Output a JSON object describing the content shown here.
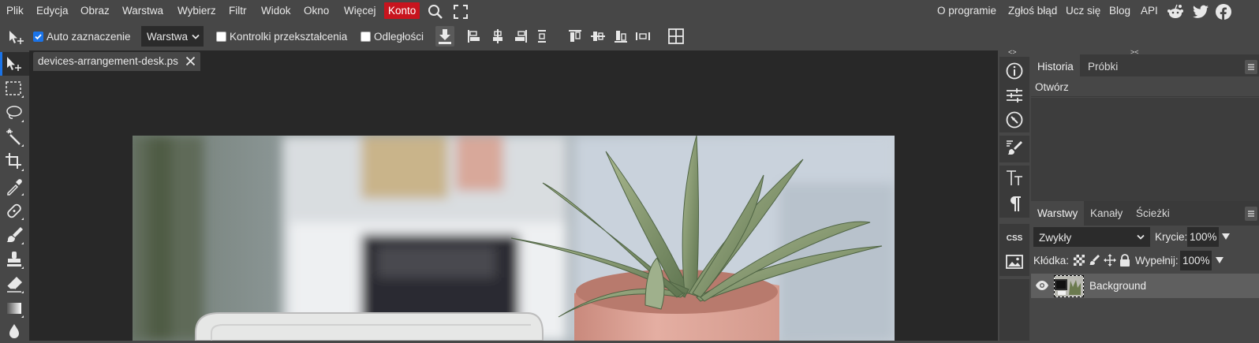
{
  "menu": {
    "items": [
      "Plik",
      "Edycja",
      "Obraz",
      "Warstwa",
      "Wybierz",
      "Filtr",
      "Widok",
      "Okno",
      "Więcej"
    ],
    "account": "Konto",
    "right_links": [
      "O programie",
      "Zgłoś błąd",
      "Ucz się",
      "Blog",
      "API"
    ],
    "accent_color": "#c8141e"
  },
  "options": {
    "auto_select_label": "Auto zaznaczenie",
    "auto_select_checked": true,
    "target_select": "Warstwa",
    "transform_controls_label": "Kontrolki przekształcenia",
    "transform_controls_checked": false,
    "distances_label": "Odległości",
    "distances_checked": false
  },
  "document": {
    "tab_title": "devices-arrangement-desk.psd"
  },
  "side_toggles": {
    "left": "<>",
    "right": "><"
  },
  "history_panel": {
    "tabs": [
      "Historia",
      "Próbki"
    ],
    "active_tab": "Historia",
    "entries": [
      "Otwórz"
    ]
  },
  "layers_panel": {
    "tabs": [
      "Warstwy",
      "Kanały",
      "Ścieżki"
    ],
    "active_tab": "Warstwy",
    "blend_mode": "Zwykły",
    "opacity_label": "Krycie:",
    "opacity_value": "100%",
    "lock_label": "Kłódka:",
    "fill_label": "Wypełnij:",
    "fill_value": "100%",
    "layers": [
      {
        "name": "Background",
        "visible": true
      }
    ]
  },
  "icons": {
    "tools": [
      "move-icon",
      "marquee-icon",
      "lasso-icon",
      "magic-wand-icon",
      "crop-icon",
      "eyedropper-icon",
      "healing-icon",
      "brush-icon",
      "stamp-icon",
      "eraser-icon",
      "gradient-icon",
      "blur-icon"
    ],
    "sidebar": [
      "info-icon",
      "adjustments-icon",
      "navigator-icon",
      "brush-settings-icon",
      "character-icon",
      "paragraph-icon",
      "css-icon",
      "image-icon"
    ],
    "social": [
      "reddit-icon",
      "twitter-icon",
      "facebook-icon"
    ]
  }
}
